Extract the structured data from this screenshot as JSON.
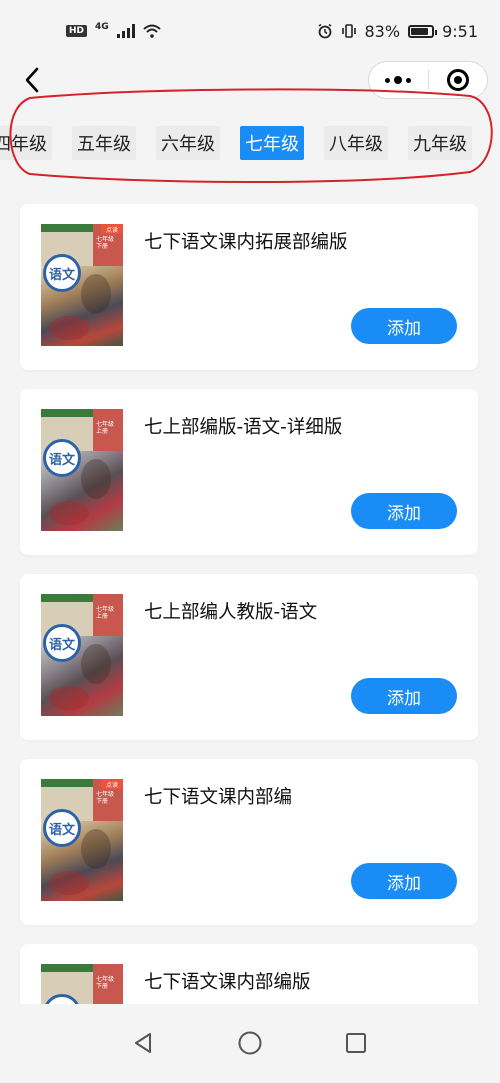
{
  "status_bar": {
    "hd_badge": "HD",
    "network": "4G",
    "battery": "83%",
    "battery_level": 0.83,
    "time": "9:51"
  },
  "nav_bar": {
    "back_icon": "chevron-left-icon",
    "more_icon": "more-dots-icon",
    "close_icon": "target-circle-icon"
  },
  "grade_tabs": {
    "items": [
      {
        "label": "四年级"
      },
      {
        "label": "五年级"
      },
      {
        "label": "六年级"
      },
      {
        "label": "七年级"
      },
      {
        "label": "八年级"
      },
      {
        "label": "九年级"
      }
    ],
    "active_index": 3
  },
  "books": [
    {
      "title": "七下语文课内拓展部编版",
      "button": "添加",
      "cover_grade": "七年级",
      "cover_volume": "下册",
      "cover_subject": "语文",
      "cover_tag": "点读"
    },
    {
      "title": "七上部编版-语文-详细版",
      "button": "添加",
      "cover_grade": "七年级",
      "cover_volume": "上册",
      "cover_subject": "语文",
      "cover_tag": ""
    },
    {
      "title": "七上部编人教版-语文",
      "button": "添加",
      "cover_grade": "七年级",
      "cover_volume": "上册",
      "cover_subject": "语文",
      "cover_tag": ""
    },
    {
      "title": "七下语文课内部编",
      "button": "添加",
      "cover_grade": "七年级",
      "cover_volume": "下册",
      "cover_subject": "语文",
      "cover_tag": "点读"
    },
    {
      "title": "七下语文课内部编版",
      "button": "添加",
      "cover_grade": "七年级",
      "cover_volume": "下册",
      "cover_subject": "语文",
      "cover_tag": ""
    }
  ],
  "system_nav": {
    "back_icon": "triangle-back-icon",
    "home_icon": "circle-home-icon",
    "recents_icon": "square-recents-icon"
  },
  "colors": {
    "accent": "#1a8cf5",
    "annotation": "#d4232a",
    "background": "#f4f4f4"
  }
}
